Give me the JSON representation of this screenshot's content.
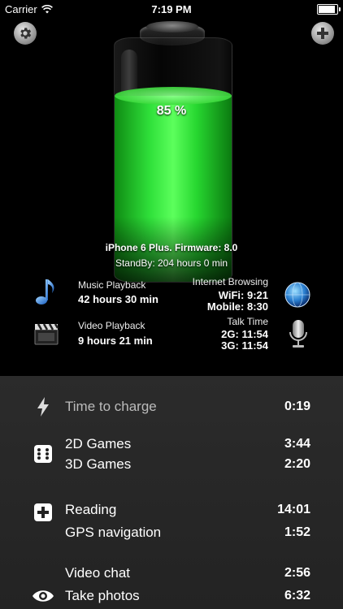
{
  "status_bar": {
    "carrier": "Carrier",
    "time": "7:19 PM",
    "battery_level": 1.0
  },
  "battery": {
    "percent_label": "85 %",
    "level": 0.85,
    "fill_color": "#2fe03a"
  },
  "device": {
    "model_firmware": "iPhone 6 Plus. Firmware: 8.0",
    "standby": "StandBy: 204 hours 0 min"
  },
  "usage": {
    "music": {
      "label": "Music Playback",
      "value": "42 hours 30 min"
    },
    "video": {
      "label": "Video Playback",
      "value": "9 hours 21 min"
    },
    "internet": {
      "label": "Internet Browsing",
      "wifi": "WiFi: 9:21",
      "mobile": "Mobile: 8:30"
    },
    "talk": {
      "label": "Talk Time",
      "g2": "2G: 11:54",
      "g3": "3G: 11:54"
    }
  },
  "list": {
    "charge": {
      "label": "Time to charge",
      "value": "0:19",
      "icon": "bolt-icon"
    },
    "games2d": {
      "label": "2D Games",
      "value": "3:44",
      "icon": "dice-icon"
    },
    "games3d": {
      "label": "3D Games",
      "value": "2:20"
    },
    "reading": {
      "label": "Reading",
      "value": "14:01",
      "icon": "plus-square-icon"
    },
    "gps": {
      "label": "GPS navigation",
      "value": "1:52"
    },
    "videochat": {
      "label": "Video chat",
      "value": "2:56"
    },
    "photos": {
      "label": "Take photos",
      "value": "6:32",
      "icon": "eye-icon"
    }
  }
}
